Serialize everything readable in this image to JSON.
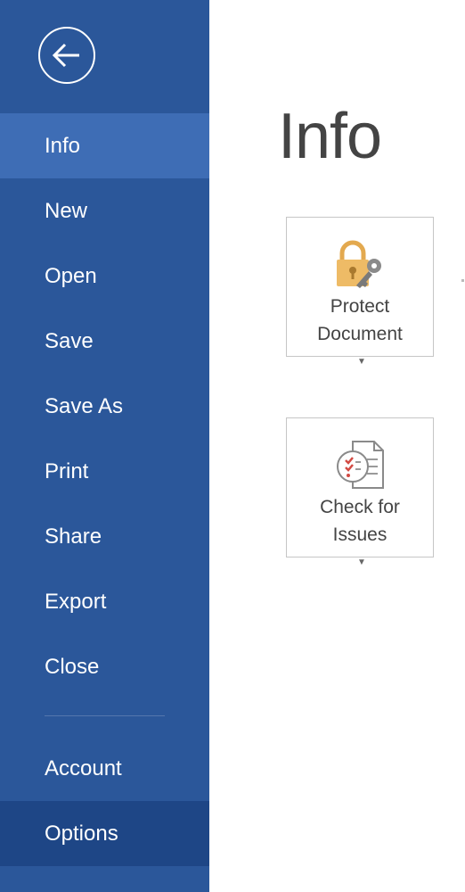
{
  "sidebar": {
    "back_icon": "back-arrow-icon",
    "items": [
      {
        "label": "Info",
        "state": "selected"
      },
      {
        "label": "New"
      },
      {
        "label": "Open"
      },
      {
        "label": "Save"
      },
      {
        "label": "Save As"
      },
      {
        "label": "Print"
      },
      {
        "label": "Share"
      },
      {
        "label": "Export"
      },
      {
        "label": "Close"
      }
    ],
    "footer_items": [
      {
        "label": "Account"
      },
      {
        "label": "Options",
        "state": "hover"
      }
    ],
    "colors": {
      "background": "#2b579a",
      "selected": "#3e6db5",
      "hover": "#1e4686"
    }
  },
  "main": {
    "title": "Info",
    "tiles": [
      {
        "line1": "Protect",
        "line2": "Document",
        "icon": "lock-key-icon",
        "has_dropdown": true
      },
      {
        "line1": "Check for",
        "line2": "Issues",
        "icon": "checklist-document-icon",
        "has_dropdown": true
      }
    ]
  }
}
